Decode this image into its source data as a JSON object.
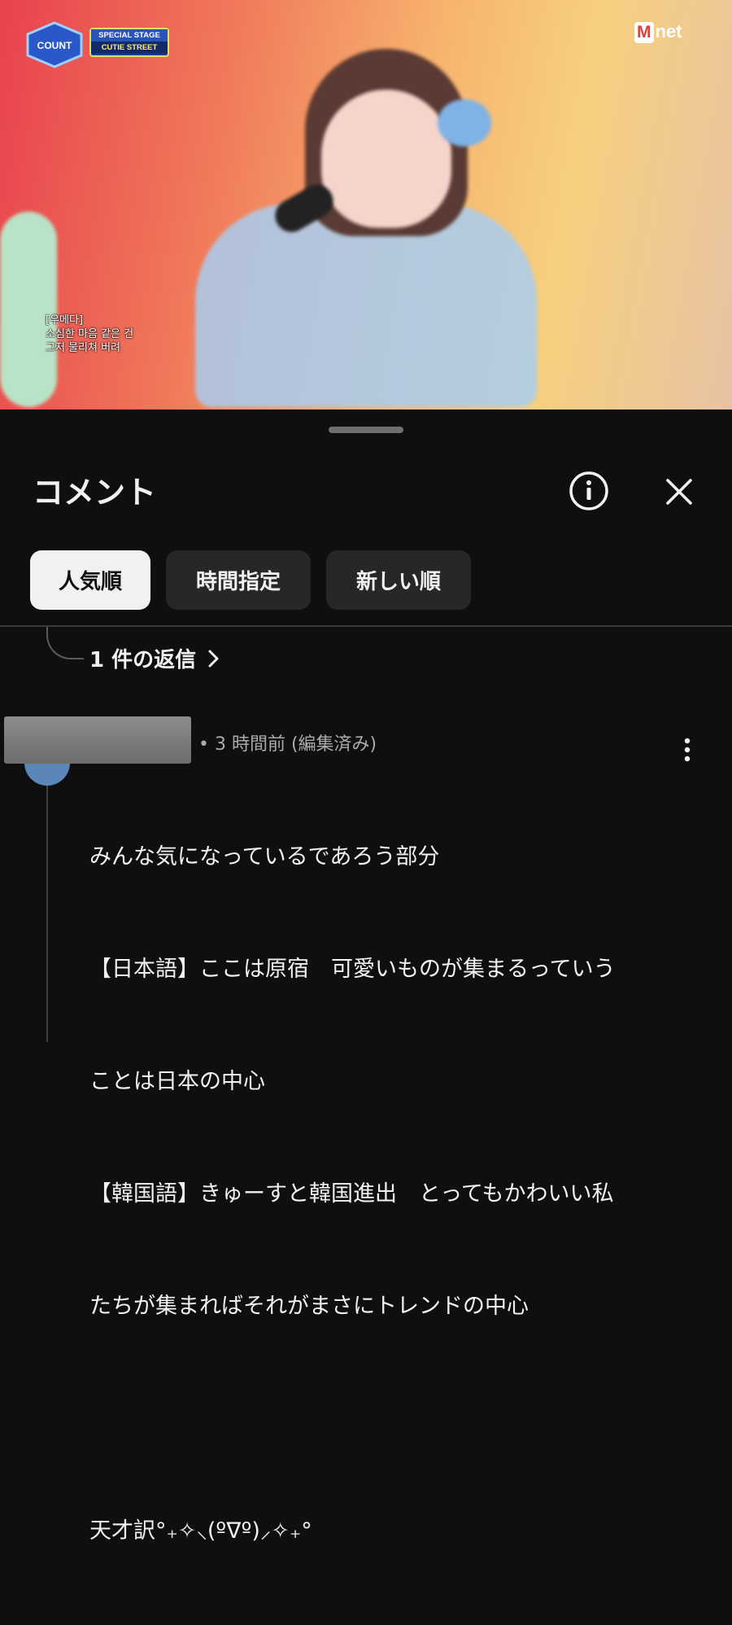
{
  "video": {
    "show_logo_text": "COUNTDOWN",
    "stage_line1": "SPECIAL STAGE",
    "stage_line2": "CUTIE STREET",
    "channel_logo_m": "M",
    "channel_logo_net": "net",
    "subtitle": [
      "[우메다]",
      "소심한 마음 같은 건",
      "그저 물리쳐 버려"
    ]
  },
  "sheet": {
    "title": "コメント",
    "info_icon": "info-circle-icon",
    "close_icon": "close-icon",
    "sort_chips": [
      {
        "label": "人気順",
        "active": true
      },
      {
        "label": "時間指定",
        "active": false
      },
      {
        "label": "新しい順",
        "active": false
      }
    ],
    "replies_label": "1 件の返信",
    "replies_icon": "chevron-right-icon"
  },
  "comment": {
    "meta": "• 3 時間前 (編集済み)",
    "more_icon": "more-vertical-icon",
    "lines": [
      "みんな気になっているであろう部分",
      "【日本語】ここは原宿　可愛いものが集まるっていう",
      "ことは日本の中心",
      "【韓国語】きゅーすと韓国進出　とってもかわいい私",
      "たちが集まればそれがまさにトレンドの中心",
      "",
      "天才訳°₊✧⸜(ºᐁº)⸝✧₊°"
    ]
  },
  "colors": {
    "background": "#0f0f0f",
    "chip_bg": "#272727",
    "chip_active_bg": "#f1f1f1",
    "text": "#f1f1f1",
    "meta_text": "#aaaaaa"
  }
}
